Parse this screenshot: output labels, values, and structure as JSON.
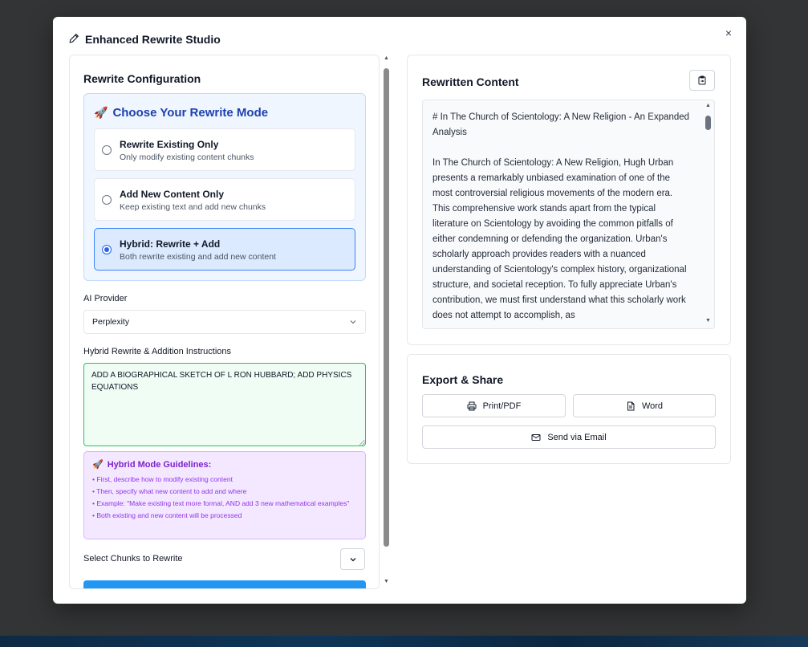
{
  "modal": {
    "title": "Enhanced Rewrite Studio",
    "close": "×"
  },
  "config": {
    "title": "Rewrite Configuration",
    "mode_header": "Choose Your Rewrite Mode",
    "modes": [
      {
        "label": "Rewrite Existing Only",
        "desc": "Only modify existing content chunks",
        "selected": false
      },
      {
        "label": "Add New Content Only",
        "desc": "Keep existing text and add new chunks",
        "selected": false
      },
      {
        "label": "Hybrid: Rewrite + Add",
        "desc": "Both rewrite existing and add new content",
        "selected": true
      }
    ],
    "provider_label": "AI Provider",
    "provider_value": "Perplexity",
    "instructions_label": "Hybrid Rewrite & Addition Instructions",
    "instructions_value": "ADD A BIOGRAPHICAL SKETCH OF L RON HUBBARD; ADD PHYSICS EQUATIONS",
    "guidelines": {
      "title": "Hybrid Mode Guidelines:",
      "items": [
        "• First, describe how to modify existing content",
        "• Then, specify what new content to add and where",
        "• Example: \"Make existing text more formal, AND add 3 new mathematical examples\"",
        "• Both existing and new content will be processed"
      ]
    },
    "chunks_label": "Select Chunks to Rewrite"
  },
  "rewritten": {
    "title": "Rewritten Content",
    "heading": "# In The Church of Scientology: A New Religion - An Expanded Analysis",
    "body": "In The Church of Scientology: A New Religion, Hugh Urban presents a remarkably unbiased examination of one of the most controversial religious movements of the modern era. This comprehensive work stands apart from the typical literature on Scientology by avoiding the common pitfalls of either condemning or defending the organization. Urban's scholarly approach provides readers with a nuanced understanding of Scientology's complex history, organizational structure, and societal reception. To fully appreciate Urban's contribution, we must first understand what this scholarly work does not attempt to accomplish, as"
  },
  "export": {
    "title": "Export & Share",
    "print_label": "Print/PDF",
    "word_label": "Word",
    "email_label": "Send via Email"
  }
}
